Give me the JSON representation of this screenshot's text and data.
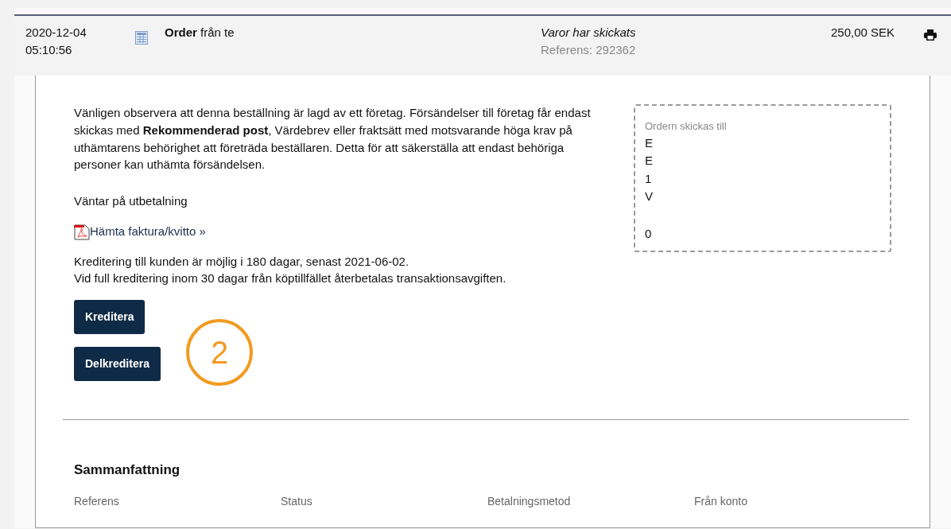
{
  "order": {
    "date": "2020-12-04",
    "time": "05:10:56",
    "title_bold": "Order",
    "title_rest": "från te",
    "status": "Varor har skickats",
    "reference": "Referens: 292362",
    "amount": "250,00 SEK"
  },
  "notice": "Vänligen observera att denna beställning är lagd av ett företag. Försändelser till företag får endast skickas med **Rekommenderad post**, Värdebrev eller fraktsätt med motsvarande höga krav på uthämtarens behörighet att företräda beställaren. Detta för att säkerställa att endast behöriga personer kan uthämta försändelsen.",
  "payment_status": "Väntar på utbetalning",
  "invoice_link": "Hämta faktura/kvitto »",
  "credit_info": [
    "Kreditering till kunden är möjlig i 180 dagar, senast 2021-06-02.",
    "Vid full kreditering inom 30 dagar från köptillfället återbetalas transaktionsavgiften."
  ],
  "buttons": [
    "Kreditera",
    "Delkreditera"
  ],
  "annotation": "2",
  "shipping": {
    "label": "Ordern skickas till",
    "lines": [
      "E",
      "E",
      "1",
      "V"
    ],
    "phone": "0"
  },
  "summary": {
    "title": "Sammanfattning",
    "columns": [
      "Referens",
      "Status",
      "Betalningsmetod",
      "Från konto"
    ]
  }
}
